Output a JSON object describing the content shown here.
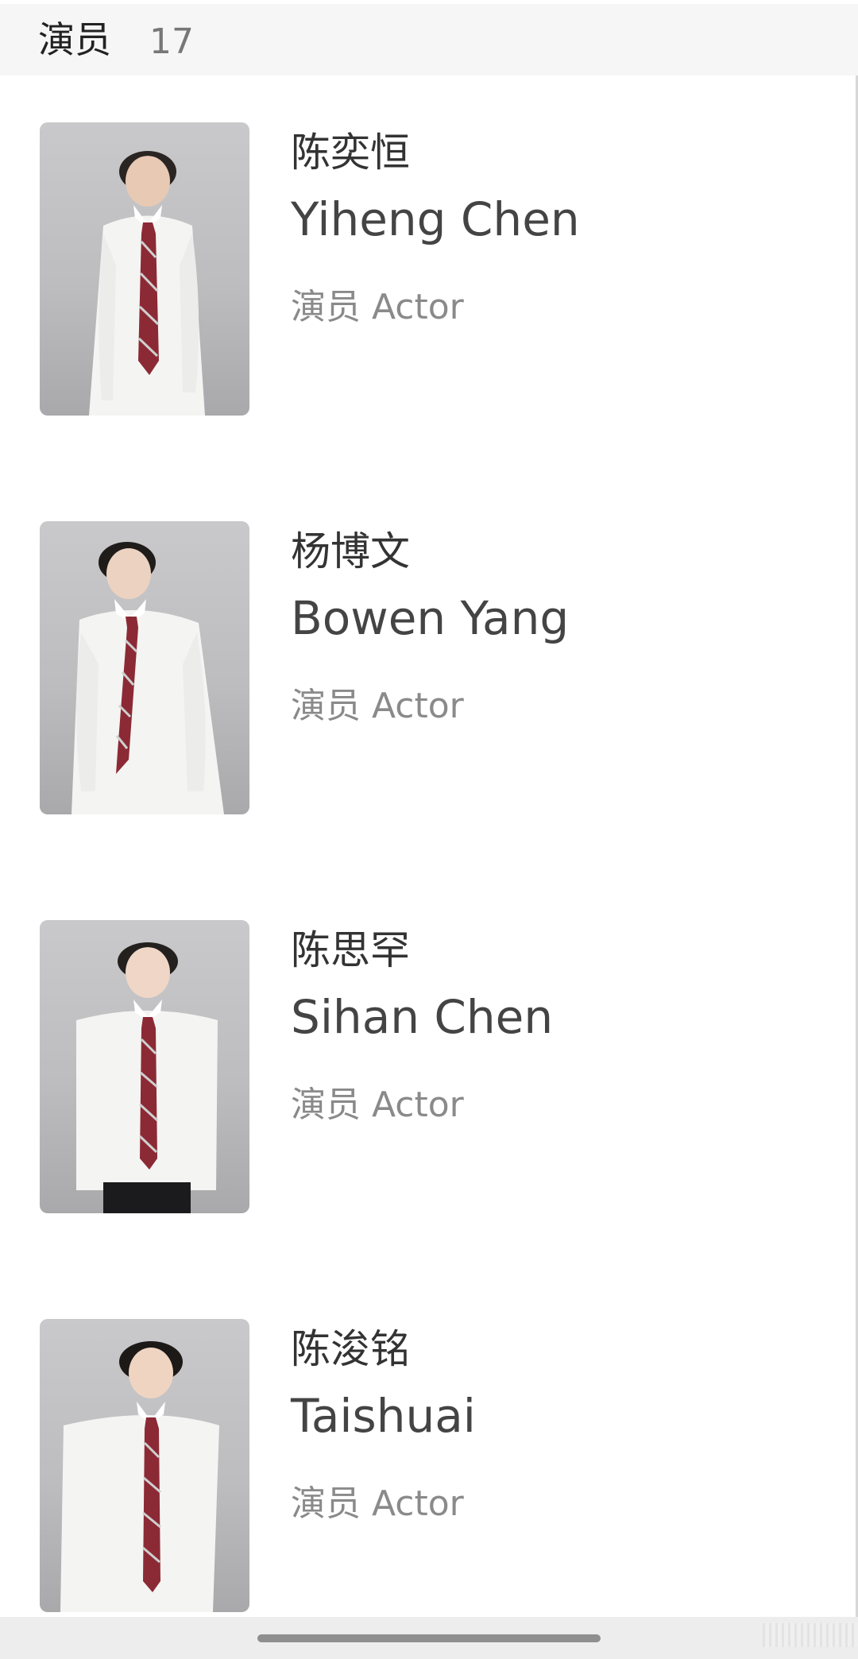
{
  "header": {
    "title": "演员",
    "count": "17"
  },
  "cast": [
    {
      "name_cn": "陈奕恒",
      "name_en": "Yiheng Chen",
      "role": "演员 Actor"
    },
    {
      "name_cn": "杨博文",
      "name_en": "Bowen Yang",
      "role": "演员 Actor"
    },
    {
      "name_cn": "陈思罕",
      "name_en": "Sihan Chen",
      "role": "演员 Actor"
    },
    {
      "name_cn": "陈浚铭",
      "name_en": "Taishuai",
      "role": "演员 Actor"
    }
  ],
  "colors": {
    "header_bg": "#f6f6f6",
    "name_text": "#333333",
    "role_text": "#8a8a8a",
    "tie": "#8b2a35"
  }
}
